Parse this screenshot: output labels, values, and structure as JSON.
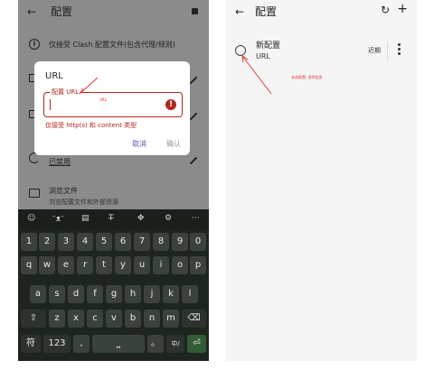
{
  "left": {
    "topbar": {
      "title": "配置"
    },
    "info_row": {
      "text": "仅接受 Clash 配置文件(包含代理/规则)"
    },
    "disabled_row": {
      "text": "已禁用"
    },
    "browse_row": {
      "title": "浏览文件",
      "sub": "浏览配置文件和外部资源"
    },
    "dialog": {
      "title": "URL",
      "field_label": "配置 URL",
      "field_note": "URL",
      "helper": "仅接受 http(s) 和 content 类型",
      "cancel": "取消",
      "confirm": "确认"
    },
    "keyboard": {
      "tools": [
        "☺",
        "ᵔᴥᵔ",
        "▤",
        "T̶",
        "✥",
        "⚙",
        "⋯"
      ],
      "row1": [
        "1",
        "2",
        "3",
        "4",
        "5",
        "6",
        "7",
        "8",
        "9",
        "0"
      ],
      "row2": [
        "q",
        "w",
        "e",
        "r",
        "t",
        "y",
        "u",
        "i",
        "o",
        "p"
      ],
      "row3": [
        "a",
        "s",
        "d",
        "f",
        "g",
        "h",
        "j",
        "k",
        "l"
      ],
      "row4": [
        "z",
        "x",
        "c",
        "v",
        "b",
        "n",
        "m"
      ],
      "shift": "⇧",
      "backspace": "⌫",
      "sym": "符",
      "num": "123",
      "comma": ",",
      "space": "⎵",
      "period": "。",
      "lang": "中/",
      "enter": "⏎"
    }
  },
  "right": {
    "title": "配置",
    "config_name": "新配置",
    "config_type": "URL",
    "config_time": "近期",
    "note": "未选配置, 说明信息"
  }
}
